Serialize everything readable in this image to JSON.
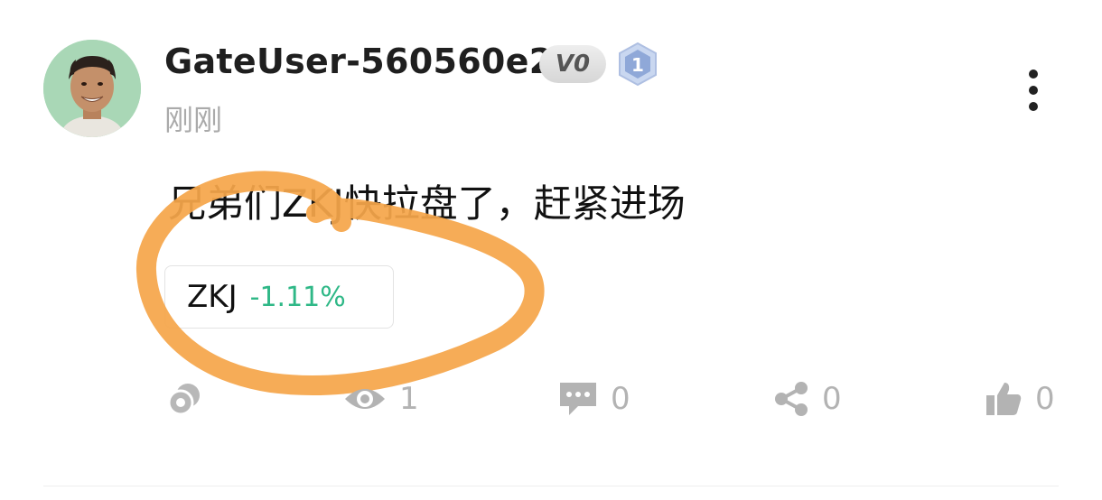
{
  "post": {
    "author": {
      "username": "GateUser-560560e2",
      "vip_label": "V0",
      "level": "1"
    },
    "timestamp": "刚刚",
    "content": "兄弟们ZKJ快拉盘了，赶紧进场",
    "ticker": {
      "symbol": "ZKJ",
      "change": "-1.11%",
      "change_color": "#2fb887"
    },
    "actions": {
      "tip_icon": "coins-icon",
      "views": "1",
      "comments": "0",
      "shares": "0",
      "likes": "0"
    }
  },
  "colors": {
    "highlight": "#f5a64a",
    "muted": "#b3b3b3"
  }
}
